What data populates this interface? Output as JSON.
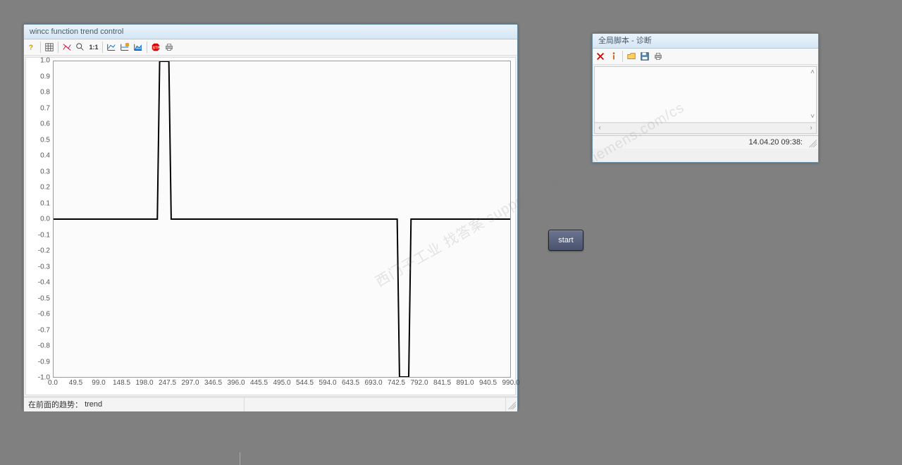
{
  "trend_panel": {
    "title": "wincc function trend control",
    "status_label": "在前面的趋势：",
    "status_value": "trend",
    "toolbar_icons": [
      "help",
      "grid",
      "strike",
      "zoom-out",
      "one-to-one",
      "chart-line",
      "chart-edit",
      "chart-area",
      "stop",
      "print"
    ]
  },
  "diag_panel": {
    "title": "全局脚本 - 诊断",
    "timestamp": "14.04.20  09:38:",
    "toolbar_icons": [
      "delete",
      "info",
      "sep",
      "open",
      "save",
      "print"
    ]
  },
  "start_button": {
    "label": "start"
  },
  "watermark": "西门子工业 找答案  support.industry.siemens.com/cs",
  "chart_data": {
    "type": "line",
    "xlabel": "",
    "ylabel": "",
    "xlim": [
      0,
      990
    ],
    "ylim": [
      -1.0,
      1.0
    ],
    "x_ticks": [
      0.0,
      49.5,
      99.0,
      148.5,
      198.0,
      247.5,
      297.0,
      346.5,
      396.0,
      445.5,
      495.0,
      544.5,
      594.0,
      643.5,
      693.0,
      742.5,
      792.0,
      841.5,
      891.0,
      940.5,
      990.0
    ],
    "y_ticks": [
      1.0,
      0.9,
      0.8,
      0.7,
      0.6,
      0.5,
      0.4,
      0.3,
      0.2,
      0.1,
      -0.0,
      -0.1,
      -0.2,
      -0.3,
      -0.4,
      -0.5,
      -0.6,
      -0.7,
      -0.8,
      -0.9,
      -1.0
    ],
    "series": [
      {
        "name": "trend",
        "x": [
          0,
          225,
          230,
          250,
          255,
          745,
          750,
          770,
          775,
          990
        ],
        "values": [
          0.0,
          0.0,
          1.0,
          1.0,
          0.0,
          0.0,
          -1.0,
          -1.0,
          0.0,
          0.0
        ]
      }
    ]
  }
}
